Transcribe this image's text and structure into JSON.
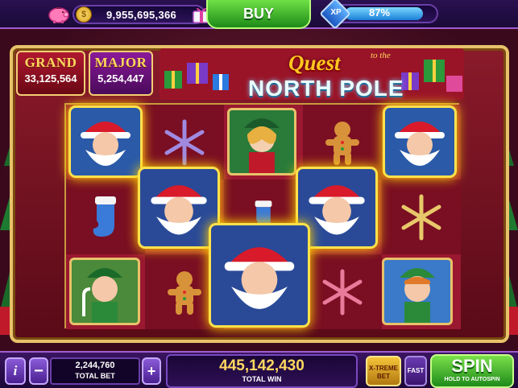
{
  "topbar": {
    "coin_symbol": "$",
    "coins": "9,955,695,366",
    "buy_label": "BUY",
    "xp_label": "XP",
    "xp_percent": "87%",
    "xp_progress": 0.87
  },
  "jackpots": {
    "grand": {
      "label": "GRAND",
      "value": "33,125,564"
    },
    "major": {
      "label": "MAJOR",
      "value": "5,254,447"
    }
  },
  "title": {
    "quest": "Quest",
    "to_the": "to the",
    "north_pole": "NORTH POLE"
  },
  "reels": {
    "columns": 5,
    "rows": 3,
    "symbols": [
      [
        "santa",
        "stocking",
        "elf-candy-cane"
      ],
      [
        "snowflake-purple",
        "santa-wild",
        "gingerbread"
      ],
      [
        "elf-girl",
        "stocking",
        "santa-wild-big"
      ],
      [
        "gingerbread",
        "santa-wild",
        "snowflake-pink"
      ],
      [
        "santa",
        "snowflake-gold",
        "elf-boy"
      ]
    ]
  },
  "controls": {
    "info_label": "i",
    "minus_label": "−",
    "plus_label": "+",
    "total_bet_value": "2,244,760",
    "total_bet_label": "TOTAL BET",
    "total_win_value": "445,142,430",
    "total_win_label": "TOTAL WIN",
    "xtreme_line1": "X-TREME",
    "xtreme_line2": "BET",
    "fast_label": "FAST",
    "spin_label": "SPIN",
    "spin_sub": "HOLD TO AUTOSPIN"
  },
  "colors": {
    "accent_gold": "#ffd860",
    "spin_green": "#1e8a1a",
    "frame_gold": "#e8c26a",
    "reel_red": "#7a0e22"
  }
}
